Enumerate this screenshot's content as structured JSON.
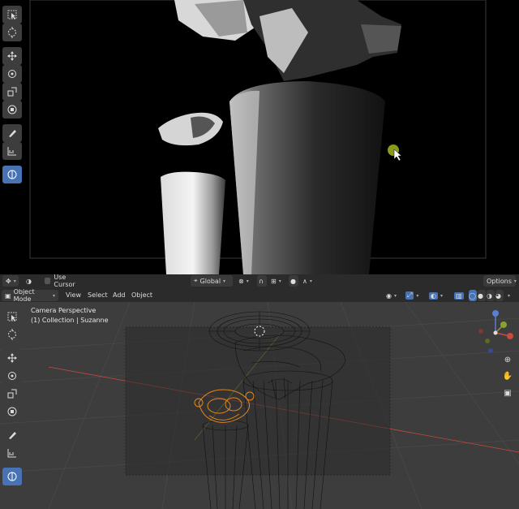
{
  "header": {
    "use_cursor_label": "Use Cursor",
    "orientation_value": "Global",
    "options_label": "Options"
  },
  "mode_bar": {
    "mode_value": "Object Mode",
    "menus": [
      "View",
      "Select",
      "Add",
      "Object"
    ]
  },
  "viewport": {
    "view_name": "Camera Perspective",
    "collection_info": "(1) Collection | Suzanne"
  },
  "colors": {
    "accent": "#4772b3",
    "selection_orange": "#e8861a",
    "x_axis": "#c84a3c",
    "y_axis": "#8aa030",
    "cursor_dot": "#8a9a1a"
  },
  "icons": {
    "tools": [
      "select-box-icon",
      "cursor-icon",
      "move-icon",
      "rotate-icon",
      "scale-icon",
      "transform-icon",
      "annotate-icon",
      "measure-icon",
      "add-cube-icon"
    ],
    "nav": [
      "zoom-icon",
      "pan-hand-icon",
      "camera-icon"
    ]
  }
}
